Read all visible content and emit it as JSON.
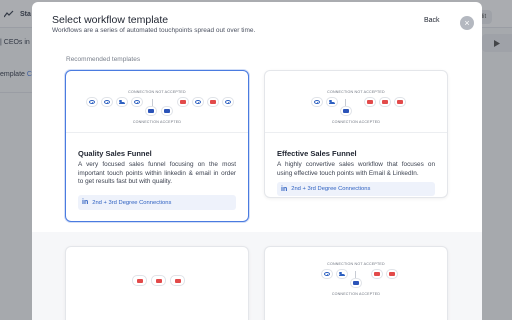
{
  "background": {
    "app_title": "Sta",
    "line1": "| CEOs in",
    "line2": "emplate",
    "line2_link": "Ch",
    "right_button": "Edit"
  },
  "modal": {
    "title": "Select workflow template",
    "subtitle": "Workflows are a series of automated touchpoints spread out over time.",
    "back_label": "Back",
    "close_icon": "×",
    "section_label": "Recommended templates"
  },
  "templates": [
    {
      "caption_top": "CONNECTION NOT ACCEPTED",
      "caption_bottom": "CONNECTION ACCEPTED",
      "title": "Quality Sales Funnel",
      "description": "A very focused sales funnel focusing on the most important touch points within linkedin & email in order to get results fast but with quality.",
      "tag_label": "2nd + 3rd Degree Connections",
      "selected": true
    },
    {
      "caption_top": "CONNECTION NOT ACCEPTED",
      "caption_bottom": "CONNECTION ACCEPTED",
      "title": "Effective Sales Funnel",
      "description": "A highly convertive sales workflow that focuses on using effective touch points with Email & LinkedIn.",
      "tag_label": "2nd + 3rd Degree Connections",
      "selected": false
    },
    {
      "caption_top": "",
      "caption_bottom": ""
    },
    {
      "caption_top": "CONNECTION NOT ACCEPTED",
      "caption_bottom": "CONNECTION ACCEPTED"
    }
  ],
  "icons": {
    "view": "eye-icon",
    "connect": "people-icon",
    "email": "mail-icon",
    "linkedin": "linkedin-icon"
  },
  "colors": {
    "accent": "#4a7be0",
    "linkedin_blue": "#2c5fc0",
    "email_red": "#e24a4a"
  }
}
